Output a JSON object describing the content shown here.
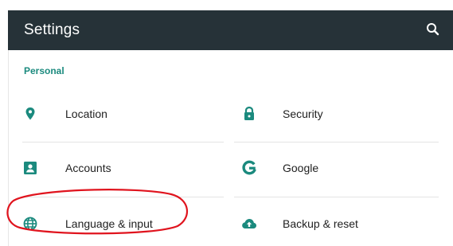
{
  "appbar": {
    "title": "Settings"
  },
  "section": {
    "header": "Personal"
  },
  "items": [
    {
      "label": "Location",
      "icon": "location-pin-icon"
    },
    {
      "label": "Security",
      "icon": "lock-icon"
    },
    {
      "label": "Accounts",
      "icon": "account-box-icon"
    },
    {
      "label": "Google",
      "icon": "google-g-icon"
    },
    {
      "label": "Language & input",
      "icon": "globe-icon"
    },
    {
      "label": "Backup & reset",
      "icon": "cloud-upload-icon"
    }
  ],
  "colors": {
    "appbar_bg": "#263238",
    "accent": "#1b8a7e",
    "annotation": "#e0141e"
  },
  "annotation": {
    "highlighted_item": "Language & input"
  }
}
